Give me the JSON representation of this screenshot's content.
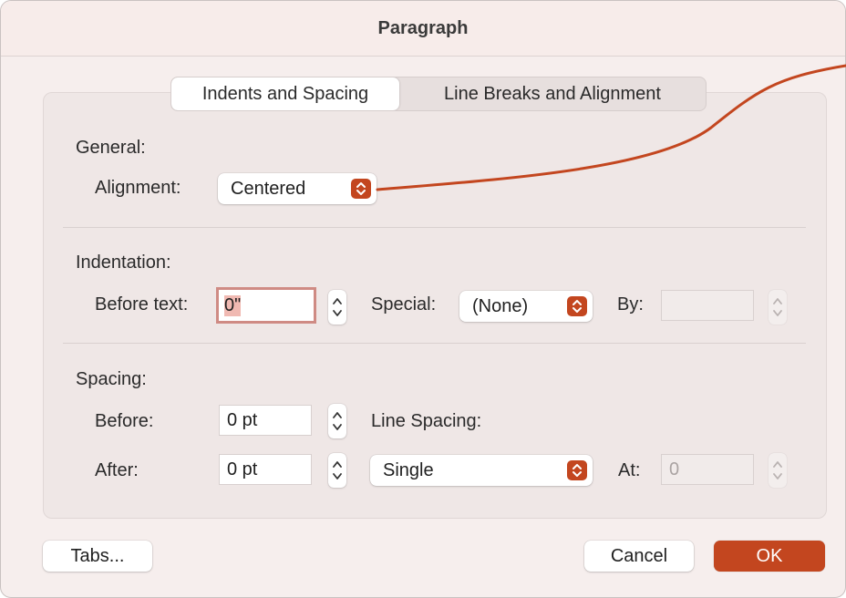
{
  "dialog": {
    "title": "Paragraph"
  },
  "tabs": [
    {
      "label": "Indents and Spacing",
      "active": true
    },
    {
      "label": "Line Breaks and Alignment",
      "active": false
    }
  ],
  "general": {
    "heading": "General:",
    "alignment_label": "Alignment:",
    "alignment_value": "Centered"
  },
  "indentation": {
    "heading": "Indentation:",
    "before_text_label": "Before text:",
    "before_text_value": "0\"",
    "special_label": "Special:",
    "special_value": "(None)",
    "by_label": "By:",
    "by_value": ""
  },
  "spacing": {
    "heading": "Spacing:",
    "before_label": "Before:",
    "before_value": "0 pt",
    "after_label": "After:",
    "after_value": "0 pt",
    "line_spacing_label": "Line Spacing:",
    "line_spacing_value": "Single",
    "at_label": "At:",
    "at_value": "0"
  },
  "buttons": {
    "tabs_label": "Tabs...",
    "cancel_label": "Cancel",
    "ok_label": "OK"
  },
  "colors": {
    "accent": "#c3461f",
    "dialog_bg": "#f6eeed",
    "focus_ring": "#cf8b84"
  },
  "icons": {
    "popup": "chevron-up-down-icon",
    "stepper": "stepper-arrows-icon"
  }
}
